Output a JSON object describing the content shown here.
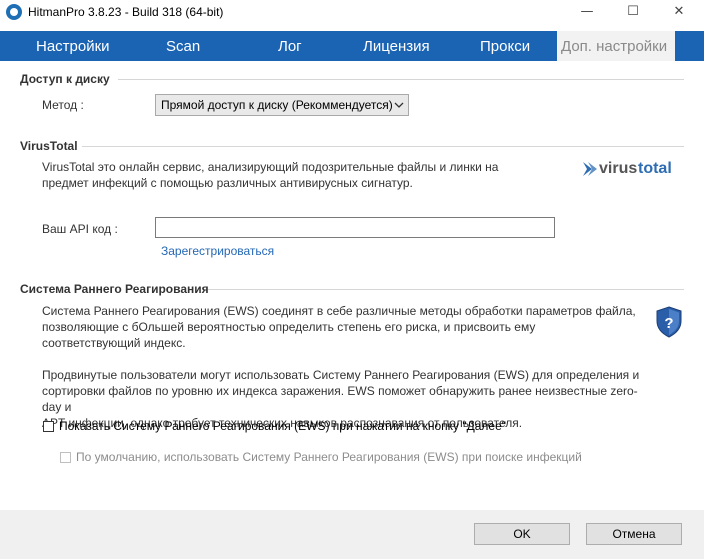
{
  "window": {
    "title": "HitmanPro 3.8.23 - Build 318 (64-bit)",
    "minimize": "—",
    "maximize": "☐",
    "close": "✕"
  },
  "tabs": [
    {
      "label": "Настройки"
    },
    {
      "label": "Scan"
    },
    {
      "label": "Лог"
    },
    {
      "label": "Лицензия"
    },
    {
      "label": "Прокси"
    },
    {
      "label": "Доп. настройки",
      "active": true
    }
  ],
  "disk_access": {
    "title": "Доступ к диску",
    "method_label": "Метод :",
    "method_value": "Прямой доступ к диску (Рекоммендуется)"
  },
  "virustotal": {
    "title": "VirusTotal",
    "description_line1": "VirusTotal это онлайн сервис, анализирующий подозрительные файлы и линки на",
    "description_line2": "предмет инфекций с помощью различных антивирусных сигнатур.",
    "logo_text_left": "virus",
    "logo_text_right": "total",
    "api_label": "Ваш API код :",
    "api_value": "",
    "register_link": "Зарегестрироваться"
  },
  "ews": {
    "title": "Система Раннего Реагирования",
    "p1_line1": "Система Раннего Реагирования (EWS) соединят в себе различные методы обработки параметров файла,",
    "p1_line2": "позволяющие с бОльшей вероятностью определить степень его риска, и присвоить ему",
    "p1_line3": "соответствующий индекс.",
    "p2_line1": "Продвинутые пользователи могут использовать Систему Раннего Реагирования (EWS) для определения и",
    "p2_line2": "сортировки файлов по уровню их индекса заражения. EWS поможет обнаружить ранее неизвестные zero-day и",
    "p2_line3": "APT инфекции, однако требует технических навыков распознавания от пользователя.",
    "checkbox1_label": "Показать Систему Раннего Реагирования (EWS) при нажатии на кнопку \"Далее\"",
    "checkbox1_checked": false,
    "checkbox2_label": "По умолчанию, использовать Систему Раннего Реагирования (EWS) при поиске инфекций",
    "checkbox2_checked": false,
    "checkbox2_enabled": false
  },
  "footer": {
    "ok_label": "OK",
    "cancel_label": "Отмена"
  },
  "colors": {
    "tab_bar": "#1b64b4",
    "link": "#2468b5",
    "shield": "#2a5ea8",
    "vt_blue": "#2f6db3"
  }
}
